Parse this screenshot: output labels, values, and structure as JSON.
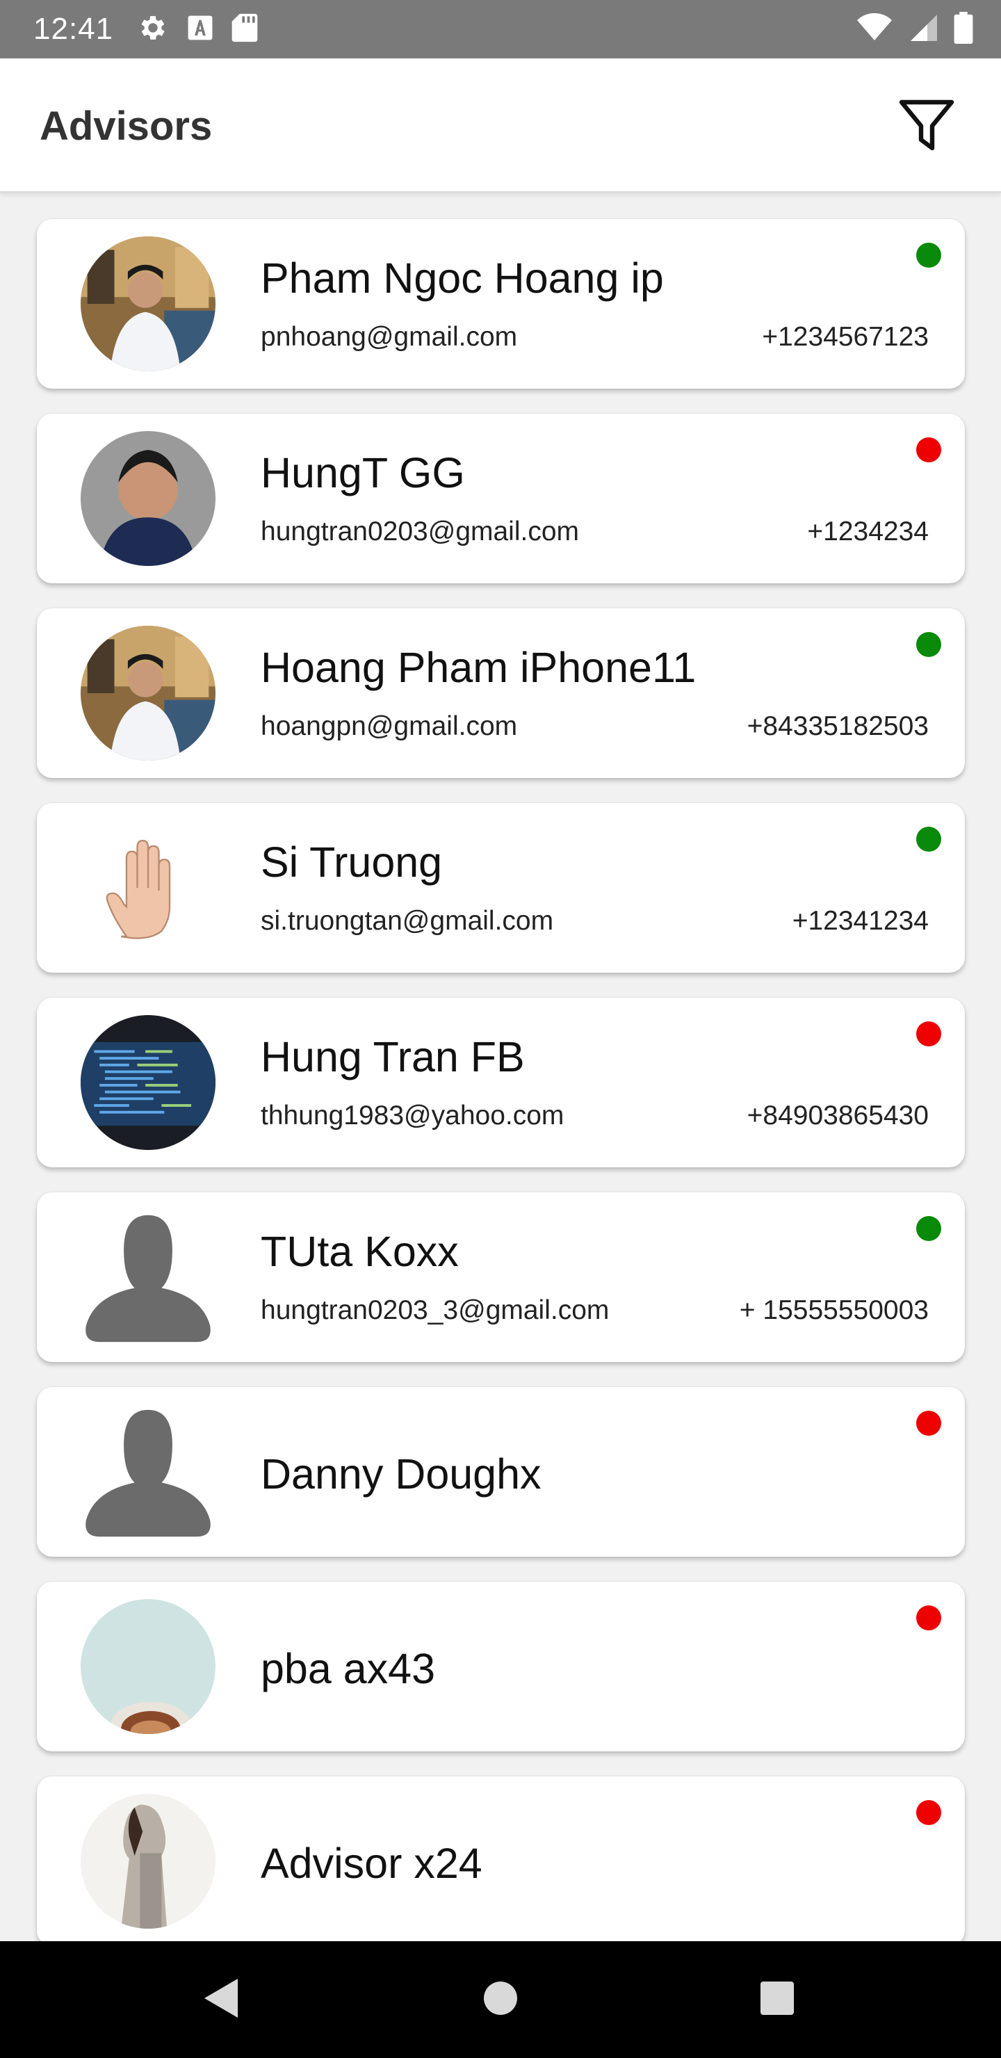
{
  "status_bar": {
    "time": "12:41",
    "icons": [
      "gear-icon",
      "a-icon",
      "sd-card-icon",
      "wifi-icon",
      "signal-icon",
      "battery-icon"
    ]
  },
  "app_bar": {
    "title": "Advisors",
    "filter_icon": "filter-icon"
  },
  "colors": {
    "online": "#0a8a0a",
    "offline": "#ee0000",
    "status_bar": "#7a7a7a",
    "nav_bar": "#000000"
  },
  "advisors": [
    {
      "name": "Pham Ngoc Hoang ip",
      "email": "pnhoang@gmail.com",
      "phone": "+1234567123",
      "status": "online"
    },
    {
      "name": "HungT GG",
      "email": "hungtran0203@gmail.com",
      "phone": "+1234234",
      "status": "offline"
    },
    {
      "name": "Hoang Pham iPhone11",
      "email": "hoangpn@gmail.com",
      "phone": "+84335182503",
      "status": "online"
    },
    {
      "name": "Si Truong",
      "email": "si.truongtan@gmail.com",
      "phone": "+12341234",
      "status": "online"
    },
    {
      "name": "Hung Tran FB",
      "email": "thhung1983@yahoo.com",
      "phone": "+84903865430",
      "status": "offline"
    },
    {
      "name": "TUta Koxx",
      "email": "hungtran0203_3@gmail.com",
      "phone": "+ 15555550003",
      "status": "online"
    },
    {
      "name": "Danny Doughx",
      "status": "offline"
    },
    {
      "name": "pba ax43",
      "status": "offline"
    },
    {
      "name": "Advisor x24",
      "status": "offline"
    }
  ],
  "nav_bar": {
    "icons": [
      "back-icon",
      "home-icon",
      "recents-icon"
    ]
  }
}
